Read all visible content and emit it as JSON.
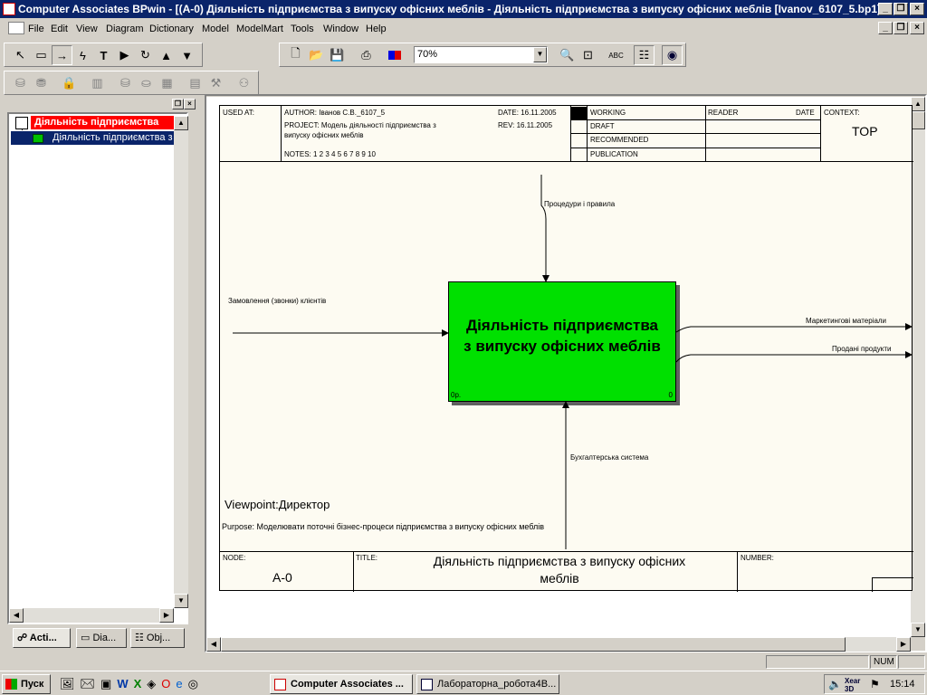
{
  "window": {
    "title": "Computer Associates BPwin - [(A-0) Діяльність підприємства  з випуску офісних меблів - Діяльність підприємства з випуску офісних меблів  [Ivanov_6107_5.bp1]]"
  },
  "menu": [
    "File",
    "Edit",
    "View",
    "Diagram",
    "Dictionary",
    "Model",
    "ModelMart",
    "Tools",
    "Window",
    "Help"
  ],
  "toolbar": {
    "zoom_value": "70%"
  },
  "tree": {
    "root_label": "Діяльність підприємства",
    "child_label": "Діяльність підприємства  з"
  },
  "tabs": [
    "Acti...",
    "Dia...",
    "Obj..."
  ],
  "header": {
    "used_at": "USED AT:",
    "author": "AUTHOR:  Іванов С.В._6107_5",
    "project": "PROJECT:  Модель діяльності підприємства з",
    "project2": "випуску офісних меблів",
    "notes": "NOTES:  1  2  3  4  5  6  7  8  9  10",
    "date": "DATE:  16.11.2005",
    "rev": "REV:    16.11.2005",
    "status": [
      "WORKING",
      "DRAFT",
      "RECOMMENDED",
      "PUBLICATION"
    ],
    "reader": "READER",
    "date_col": "DATE",
    "context": "CONTEXT:",
    "context_value": "TOP"
  },
  "diagram": {
    "box_title_line1": "Діяльність підприємства",
    "box_title_line2": "з випуску офісних меблів",
    "box_cost": "0р.",
    "box_number": "0",
    "box_color": "#00e000",
    "arrows": {
      "control": "Процедури і правила",
      "input": "Замовлення (звонки) клієнтів",
      "output1": "Маркетингові матеріали",
      "output2": "Продані продукти",
      "mechanism": "Бухгалтерська система"
    },
    "viewpoint": "Viewpoint:Директор",
    "purpose": "Purpose: Моделювати поточні бізнес-процеси підприємства з випуску офісних меблів"
  },
  "footer": {
    "node_label": "NODE:",
    "node_value": "A-0",
    "title_label": "TITLE:",
    "title_value1": "Діяльність підприємства  з випуску офісних",
    "title_value2": "меблів",
    "number_label": "NUMBER:"
  },
  "status": {
    "num": "NUM"
  },
  "taskbar": {
    "start": "Пуск",
    "tasks": [
      "Computer Associates ...",
      "Лабораторна_робота4В..."
    ],
    "clock": "15:14"
  }
}
